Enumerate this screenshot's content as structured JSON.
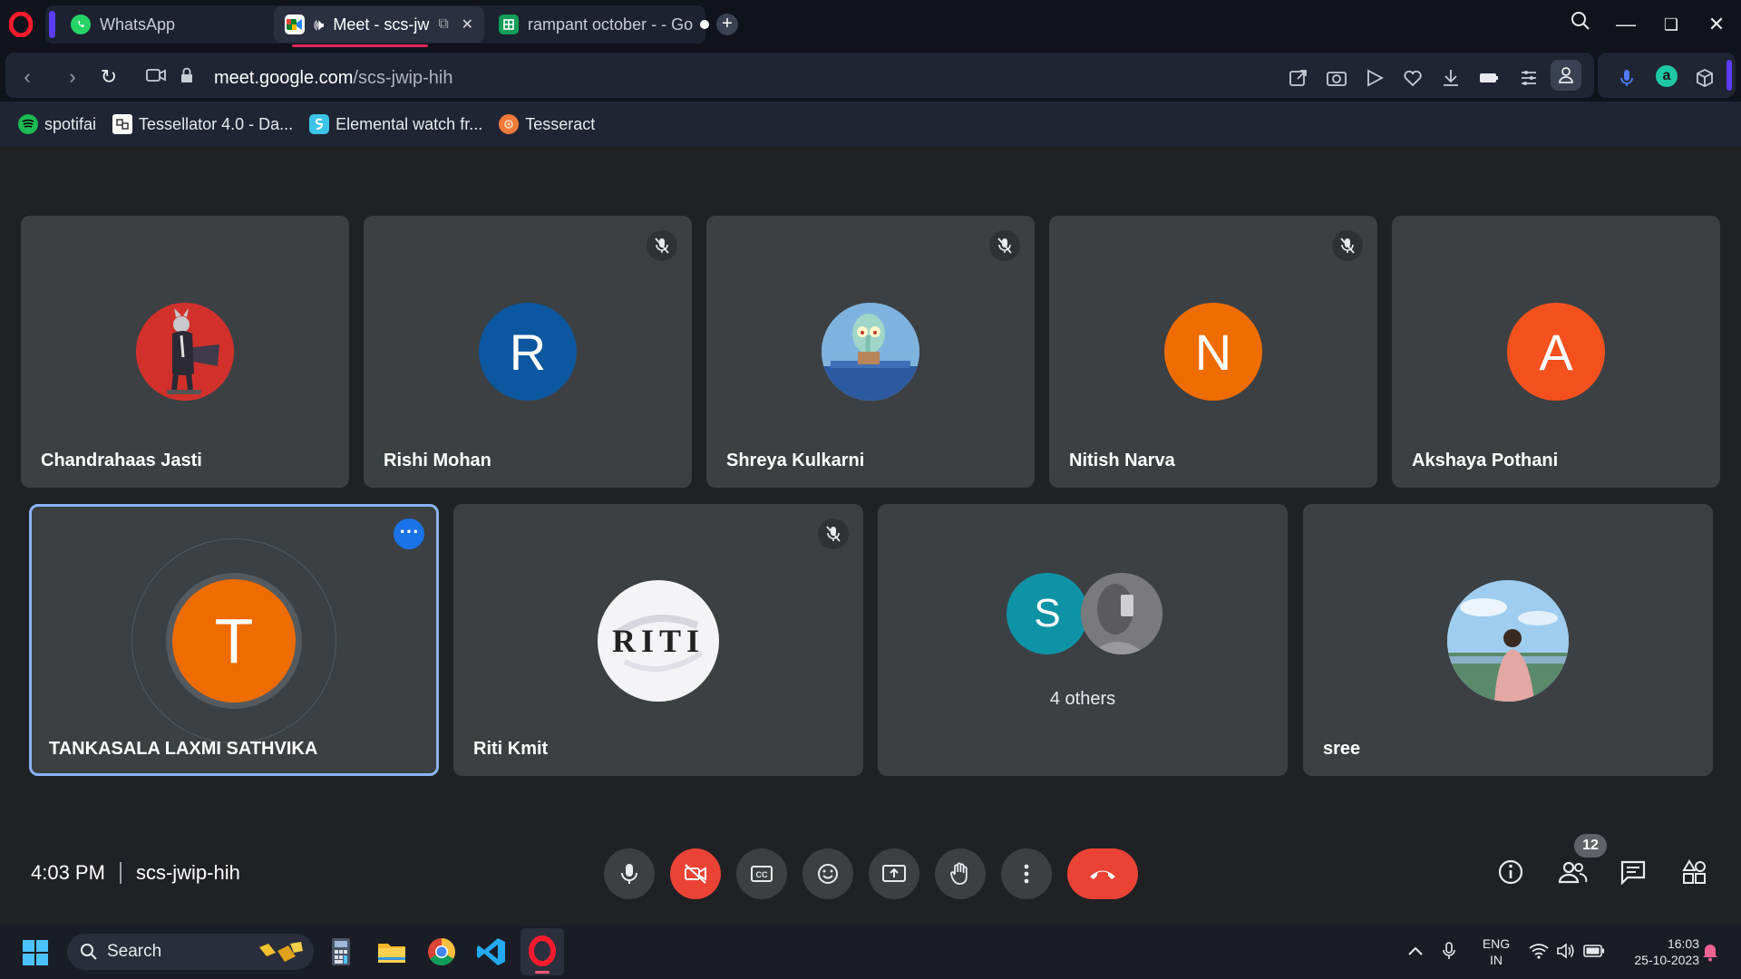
{
  "browser": {
    "tabs": [
      {
        "label": "WhatsApp"
      },
      {
        "label": "Meet - scs-jw"
      },
      {
        "label": "rampant october - - Go"
      }
    ],
    "url_host": "meet.google.com",
    "url_path": "/scs-jwip-hih"
  },
  "bookmarks": [
    {
      "label": "spotifai"
    },
    {
      "label": "Tessellator 4.0 - Da..."
    },
    {
      "label": "Elemental watch fr..."
    },
    {
      "label": "Tesseract"
    }
  ],
  "participants_row1": [
    {
      "name": "Chandrahaas Jasti",
      "avatar": "",
      "muted": false
    },
    {
      "name": "Rishi Mohan",
      "avatar": "R",
      "muted": true
    },
    {
      "name": "Shreya Kulkarni",
      "avatar": "",
      "muted": true
    },
    {
      "name": "Nitish Narva",
      "avatar": "N",
      "muted": true
    },
    {
      "name": "Akshaya Pothani",
      "avatar": "A",
      "muted": false
    }
  ],
  "participants_row2": {
    "speaker": {
      "name": "TANKASALA LAXMI SATHVIKA",
      "avatar": "T"
    },
    "riti": {
      "name": "Riti Kmit",
      "logo_text": "RITI"
    },
    "others": {
      "avatar": "S",
      "label": "4 others"
    },
    "sree": {
      "name": "sree"
    }
  },
  "meeting": {
    "time": "4:03 PM",
    "code": "scs-jwip-hih",
    "people_count": "12"
  },
  "taskbar": {
    "search_label": "Search",
    "lang_top": "ENG",
    "lang_bottom": "IN",
    "clock_time": "16:03",
    "clock_date": "25-10-2023"
  },
  "colors": {
    "tile": "#3c4043",
    "meet_bg": "#202124",
    "end_call": "#ea4335",
    "rishi_avatar": "#0b57a0",
    "nitish_avatar": "#ef6c00",
    "akshaya_avatar": "#f4511e",
    "speaker_avatar": "#ef6c00",
    "others_avatar": "#0e93a6"
  }
}
